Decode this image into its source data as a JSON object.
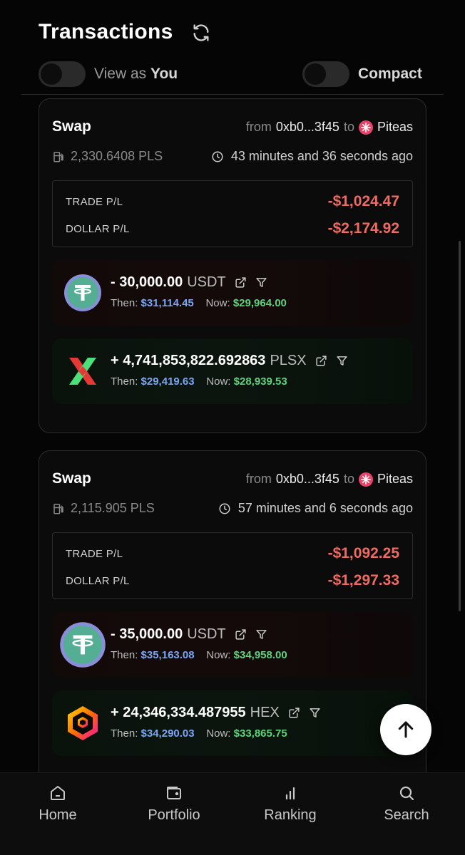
{
  "header": {
    "title": "Transactions",
    "view_as_prefix": "View as",
    "view_as_bold": "You",
    "compact_label": "Compact"
  },
  "transactions": [
    {
      "type": "Swap",
      "from_label": "from",
      "from_address": "0xb0...3f45",
      "to_label": "to",
      "to_name": "Piteas",
      "gas": "2,330.6408 PLS",
      "time_ago": "43 minutes and 36 seconds ago",
      "trade_pl_label": "TRADE P/L",
      "trade_pl_value": "-$1,024.47",
      "dollar_pl_label": "DOLLAR P/L",
      "dollar_pl_value": "-$2,174.92",
      "sent": {
        "amount": "- 30,000.00",
        "symbol": "USDT",
        "icon": "tether-icon",
        "then_label": "Then:",
        "then_value": "$31,114.45",
        "now_label": "Now:",
        "now_value": "$29,964.00"
      },
      "received": {
        "amount": "+ 4,741,853,822.692863",
        "symbol": "PLSX",
        "icon": "pulsex-icon",
        "then_label": "Then:",
        "then_value": "$29,419.63",
        "now_label": "Now:",
        "now_value": "$28,939.53"
      }
    },
    {
      "type": "Swap",
      "from_label": "from",
      "from_address": "0xb0...3f45",
      "to_label": "to",
      "to_name": "Piteas",
      "gas": "2,115.905 PLS",
      "time_ago": "57 minutes and 6 seconds ago",
      "trade_pl_label": "TRADE P/L",
      "trade_pl_value": "-$1,092.25",
      "dollar_pl_label": "DOLLAR P/L",
      "dollar_pl_value": "-$1,297.33",
      "sent": {
        "amount": "- 35,000.00",
        "symbol": "USDT",
        "icon": "tether-icon",
        "then_label": "Then:",
        "then_value": "$35,163.08",
        "now_label": "Now:",
        "now_value": "$34,958.00"
      },
      "received": {
        "amount": "+ 24,346,334.487955",
        "symbol": "HEX",
        "icon": "hex-icon",
        "then_label": "Then:",
        "then_value": "$34,290.03",
        "now_label": "Now:",
        "now_value": "$33,865.75"
      }
    }
  ],
  "nav": {
    "home": "Home",
    "portfolio": "Portfolio",
    "ranking": "Ranking",
    "search": "Search"
  },
  "colors": {
    "loss": "#ef6b62",
    "then": "#7aa6f5",
    "now": "#5fd27c",
    "tether": "#53ae94",
    "piteas": "#e8436a"
  }
}
